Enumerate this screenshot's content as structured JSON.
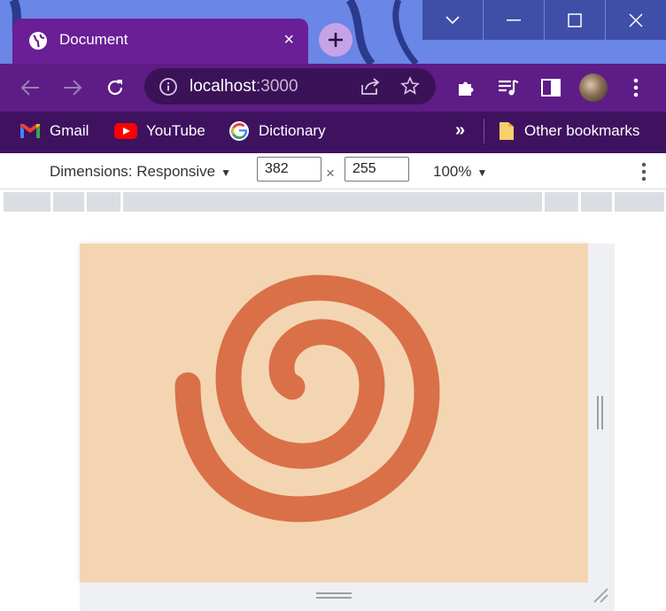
{
  "tab": {
    "title": "Document",
    "close": "×"
  },
  "omnibox": {
    "host": "localhost",
    "port": ":3000"
  },
  "bookmarks": {
    "items": [
      {
        "label": "Gmail",
        "icon": "gmail-icon"
      },
      {
        "label": "YouTube",
        "icon": "youtube-icon"
      },
      {
        "label": "Dictionary",
        "icon": "google-icon"
      }
    ],
    "overflow": "»",
    "other": "Other bookmarks"
  },
  "devtools": {
    "dimensions_label": "Dimensions: Responsive",
    "width": "382",
    "height": "255",
    "times": "×",
    "zoom": "100%"
  },
  "colors": {
    "viewport_bg": "#f4d5b2",
    "spiral": "#d97048",
    "tab_bg": "#6a1f97",
    "toolbar_bg": "#5e1c86",
    "bookmarks_bg": "#3f1260"
  }
}
